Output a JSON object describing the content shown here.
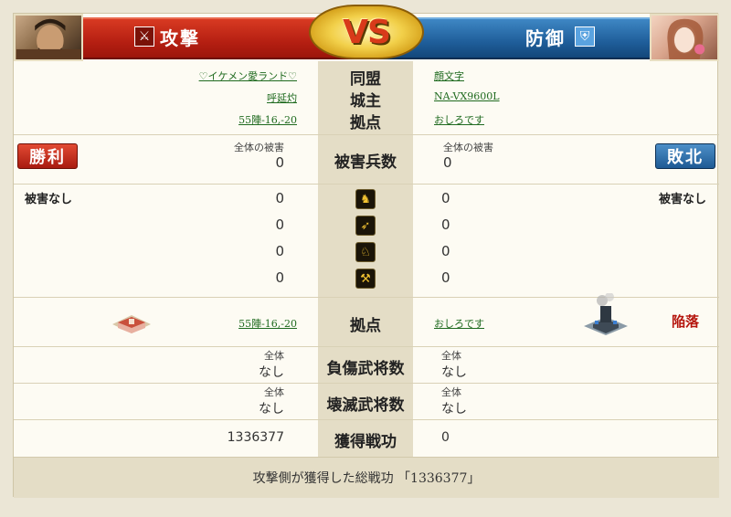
{
  "header": {
    "attack_label": "攻撃",
    "defense_label": "防御",
    "vs_text": "VS"
  },
  "info_rows": [
    {
      "label": "同盟",
      "attacker": "♡イケメン愛ランド♡",
      "defender": "顔文字"
    },
    {
      "label": "城主",
      "attacker": "呼延灼",
      "defender": "NA-VX9600L"
    },
    {
      "label": "拠点",
      "attacker": "55陣-16,-20",
      "defender": "おしろです"
    }
  ],
  "damage": {
    "label": "被害兵数",
    "attacker": {
      "result": "勝利",
      "total_label": "全体の被害",
      "total": "0",
      "note": "被害なし",
      "units": [
        "0",
        "0",
        "0",
        "0"
      ]
    },
    "defender": {
      "result": "敗北",
      "total_label": "全体の被害",
      "total": "0",
      "note": "被害なし",
      "units": [
        "0",
        "0",
        "0",
        "0"
      ]
    }
  },
  "units_icons": [
    "infantry-icon",
    "bow-icon",
    "cavalry-icon",
    "weapon-icon"
  ],
  "base": {
    "label": "拠点",
    "attacker": "55陣-16,-20",
    "defender": "おしろです",
    "status": "陥落"
  },
  "wounded": {
    "label": "負傷武将数",
    "attacker": {
      "total_label": "全体",
      "value": "なし"
    },
    "defender": {
      "total_label": "全体",
      "value": "なし"
    }
  },
  "destroyed": {
    "label": "壊滅武将数",
    "attacker": {
      "total_label": "全体",
      "value": "なし"
    },
    "defender": {
      "total_label": "全体",
      "value": "なし"
    }
  },
  "merit": {
    "label": "獲得戦功",
    "attacker": "1336377",
    "defender": "0"
  },
  "footer": {
    "text": "攻撃側が獲得した総戦功 「1336377」"
  },
  "colors": {
    "attack": "#b51f12",
    "defense": "#1f5e9a",
    "link": "#1f6a1f",
    "fallen": "#b5140c"
  }
}
